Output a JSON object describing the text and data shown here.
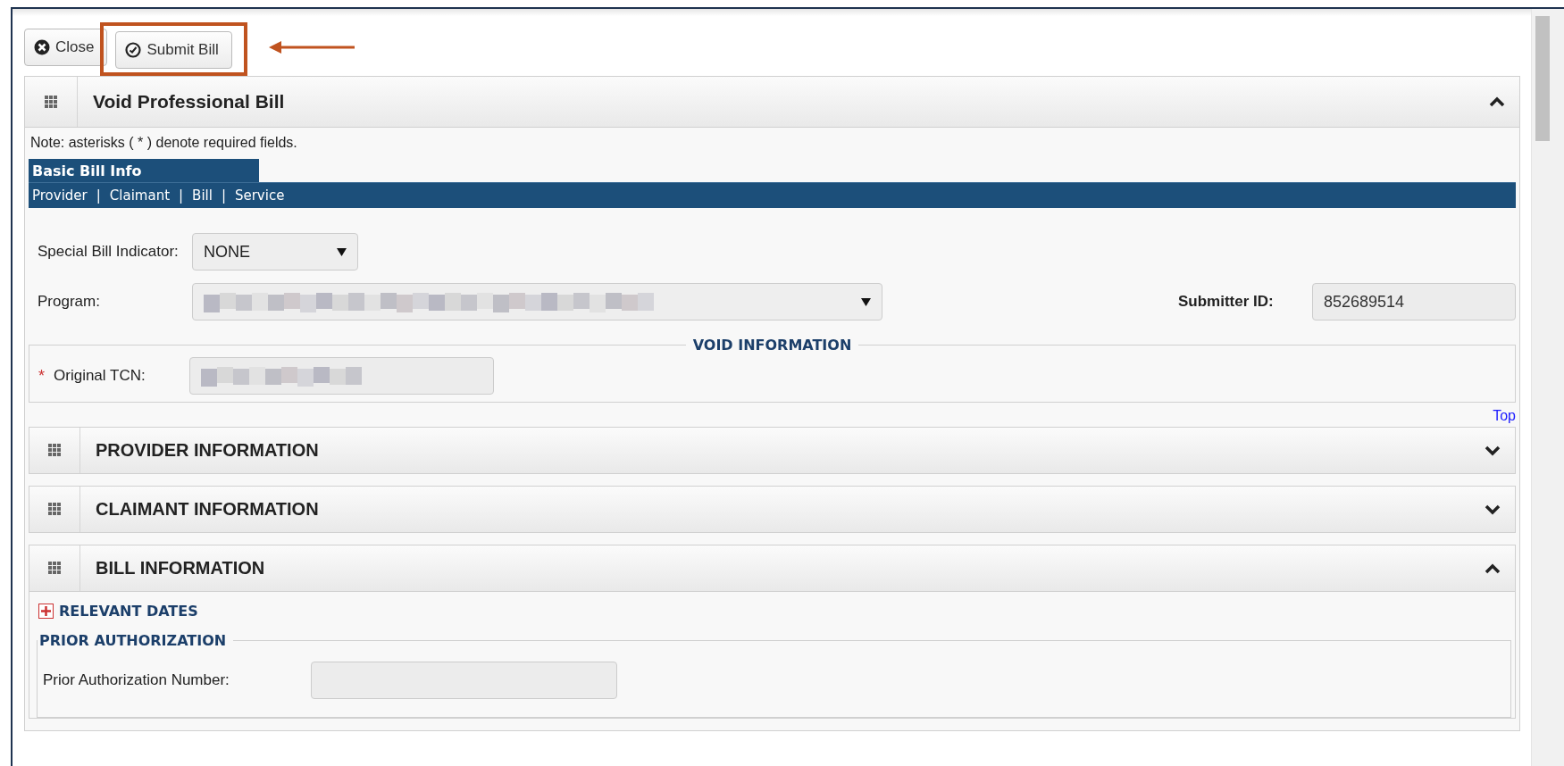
{
  "toolbar": {
    "buttons": [
      {
        "label": "Close",
        "kind": "close",
        "highlighted": false
      },
      {
        "label": "Submit Bill",
        "kind": "submit",
        "highlighted": true
      }
    ]
  },
  "main_panel": {
    "title": "Void Professional Bill",
    "expanded": true,
    "note": "Note: asterisks ( * ) denote required fields.",
    "tab": "Basic Bill Info",
    "nav_links": [
      "Provider",
      "Claimant",
      "Bill",
      "Service"
    ],
    "nav_separator": "|",
    "special_bill_indicator": {
      "label": "Special Bill Indicator:",
      "value": "NONE"
    },
    "program": {
      "label": "Program:",
      "blurred": true
    },
    "submitter_id": {
      "label": "Submitter ID:",
      "value": "852689514"
    },
    "void_information": {
      "legend": "VOID INFORMATION",
      "field": {
        "label": "Original TCN:",
        "required": true,
        "required_mark": "*",
        "blurred": true
      }
    },
    "top_link": "Top",
    "sections": [
      {
        "title": "PROVIDER INFORMATION",
        "expanded": false
      },
      {
        "title": "CLAIMANT INFORMATION",
        "expanded": false
      },
      {
        "title": "BILL INFORMATION",
        "expanded": true,
        "relevant_dates": {
          "label": "RELEVANT DATES",
          "expanded": false
        },
        "prior_authorization": {
          "legend": "PRIOR AUTHORIZATION",
          "field_label": "Prior Authorization Number:"
        }
      }
    ]
  }
}
